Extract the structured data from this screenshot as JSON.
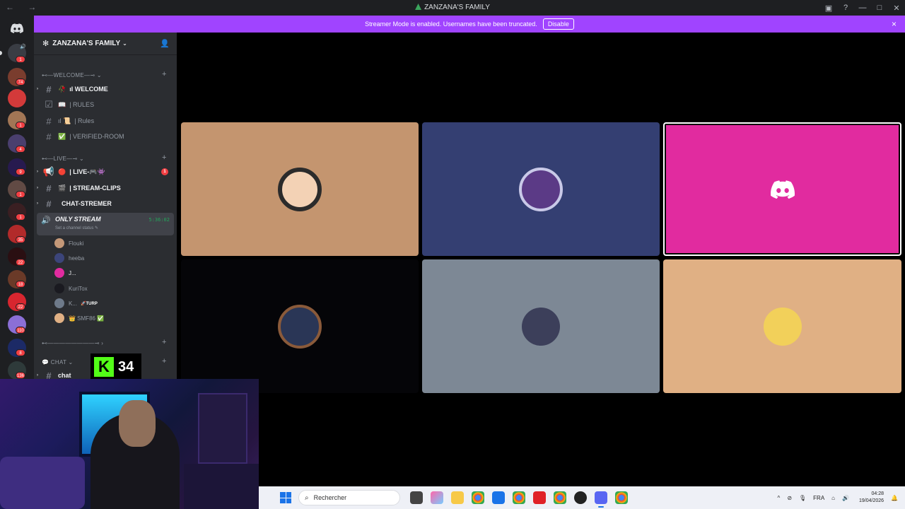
{
  "window": {
    "title": "ZANZANA'S FAMILY",
    "nav_label": "← →"
  },
  "banner": {
    "message": "Streamer Mode is enabled. Usernames have been truncated.",
    "disable_label": "Disable",
    "close_icon": "×"
  },
  "server": {
    "name": "ZANZANA'S FAMILY",
    "chevron": "⌄"
  },
  "rail": {
    "home_icon": "discord-icon",
    "badges": [
      "1",
      "74",
      "1",
      "4",
      "9",
      "1",
      "1",
      "35",
      "22",
      "18",
      "22",
      "110",
      "8",
      "136"
    ]
  },
  "categories": {
    "welcome": "⊷—WELCOME—⊸",
    "live": "⊷—LIVE—⊸",
    "divider": "⊷————————⊸",
    "chat": "💬 CHAT"
  },
  "channels": [
    {
      "icon": "#",
      "emoji": "🥀",
      "label": "ıl WELCOME"
    },
    {
      "icon": "☑",
      "emoji": "📖",
      "label": "| RULES"
    },
    {
      "icon": "#",
      "emoji": "ıl 📜",
      "label": "| Rules"
    },
    {
      "icon": "#",
      "emoji": "✅",
      "label": "| VERIFIED-ROOM"
    },
    {
      "icon": "📢",
      "emoji": "🔴",
      "label": "| LIVE-🎮👾",
      "badge": "1"
    },
    {
      "icon": "#",
      "emoji": "🎬",
      "label": "| STREAM-CLIPS"
    },
    {
      "icon": "#",
      "emoji": "",
      "label": "CHAT-STREMER"
    }
  ],
  "voice_channel": {
    "name": "ONLY STREAM",
    "status": "Set a channel status ✎",
    "timer": "5:36:02"
  },
  "voice_users": [
    {
      "name": "Flouki",
      "tag": ""
    },
    {
      "name": "heeba",
      "tag": ""
    },
    {
      "name": "J...",
      "tag": ""
    },
    {
      "name": "KuriTox",
      "tag": ""
    },
    {
      "name": "K...",
      "tag": "🚀TURP"
    },
    {
      "name": "👑 SMF86 ✅",
      "tag": ""
    }
  ],
  "chat_channel": {
    "label": "chat"
  },
  "kick": {
    "letter": "K",
    "count": "34"
  },
  "tiles": [
    {
      "color": "#c4956f"
    },
    {
      "color": "#343f72"
    },
    {
      "color": "#e12b9f",
      "discord": "discord-icon"
    },
    {
      "color": "#050508"
    },
    {
      "color": "#7d8895"
    },
    {
      "color": "#e0b084"
    }
  ],
  "taskbar": {
    "search_placeholder": "Rechercher",
    "lang": "FRA",
    "time": "04:28",
    "date": "19/04/2026"
  }
}
